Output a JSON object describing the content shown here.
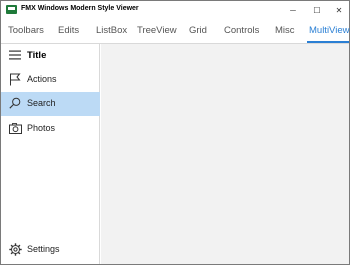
{
  "window": {
    "title": "FMX Windows Modern Style Viewer"
  },
  "titlebar_buttons": {
    "minimize": "─",
    "maximize": "☐",
    "close": "✕"
  },
  "tabs": [
    {
      "label": "Toolbars"
    },
    {
      "label": "Edits"
    },
    {
      "label": "ListBox"
    },
    {
      "label": "TreeView"
    },
    {
      "label": "Grid"
    },
    {
      "label": "Controls"
    },
    {
      "label": "Misc"
    },
    {
      "label": "MultiView"
    }
  ],
  "active_tab": "MultiView",
  "sidebar": {
    "title": "Title",
    "items": [
      {
        "label": "Actions",
        "icon": "flag-icon"
      },
      {
        "label": "Search",
        "icon": "search-icon",
        "selected": true
      },
      {
        "label": "Photos",
        "icon": "camera-icon"
      }
    ],
    "footer": {
      "label": "Settings",
      "icon": "gear-icon"
    }
  },
  "colors": {
    "accent": "#2a7fd4",
    "selected_bg": "#bcdaf5",
    "content_bg": "#f2f2f2"
  }
}
